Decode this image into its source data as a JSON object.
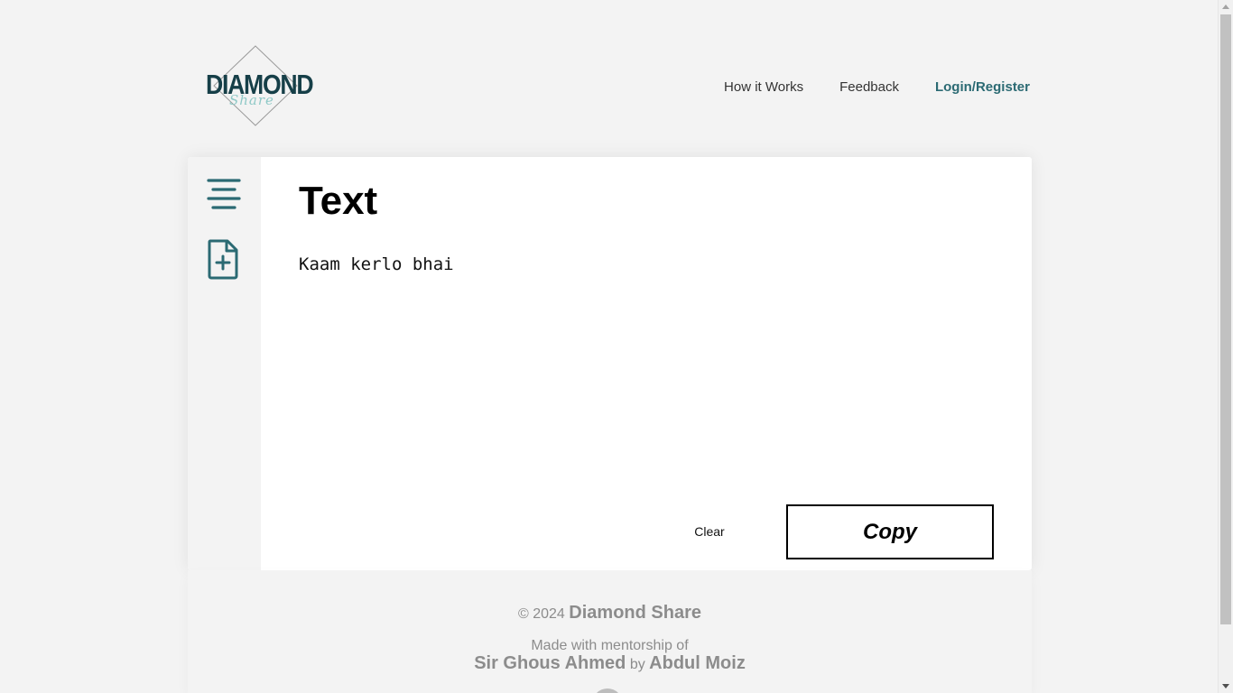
{
  "header": {
    "logo_text": "DIAMOND",
    "logo_script": "Share",
    "nav": {
      "how_it_works": "How it Works",
      "feedback": "Feedback",
      "login": "Login",
      "separator": "/",
      "register": "Register"
    }
  },
  "sidebar": {
    "icons": [
      "text-align-icon",
      "file-add-icon"
    ]
  },
  "editor": {
    "title": "Text",
    "content": "Kaam kerlo bhai",
    "clear_label": "Clear",
    "copy_label": "Copy"
  },
  "footer": {
    "copyright_symbol_year": "© 2024",
    "brand": "Diamond Share",
    "made_with": "Made with mentorship of",
    "mentor": "Sir Ghous Ahmed",
    "by": "by",
    "author": "Abdul Moiz"
  },
  "colors": {
    "accent": "#2b6a73",
    "logo": "#163f48",
    "logo_script": "#8fc9c7",
    "background": "#f3f3f3",
    "footer_text": "#8c8c8c"
  }
}
